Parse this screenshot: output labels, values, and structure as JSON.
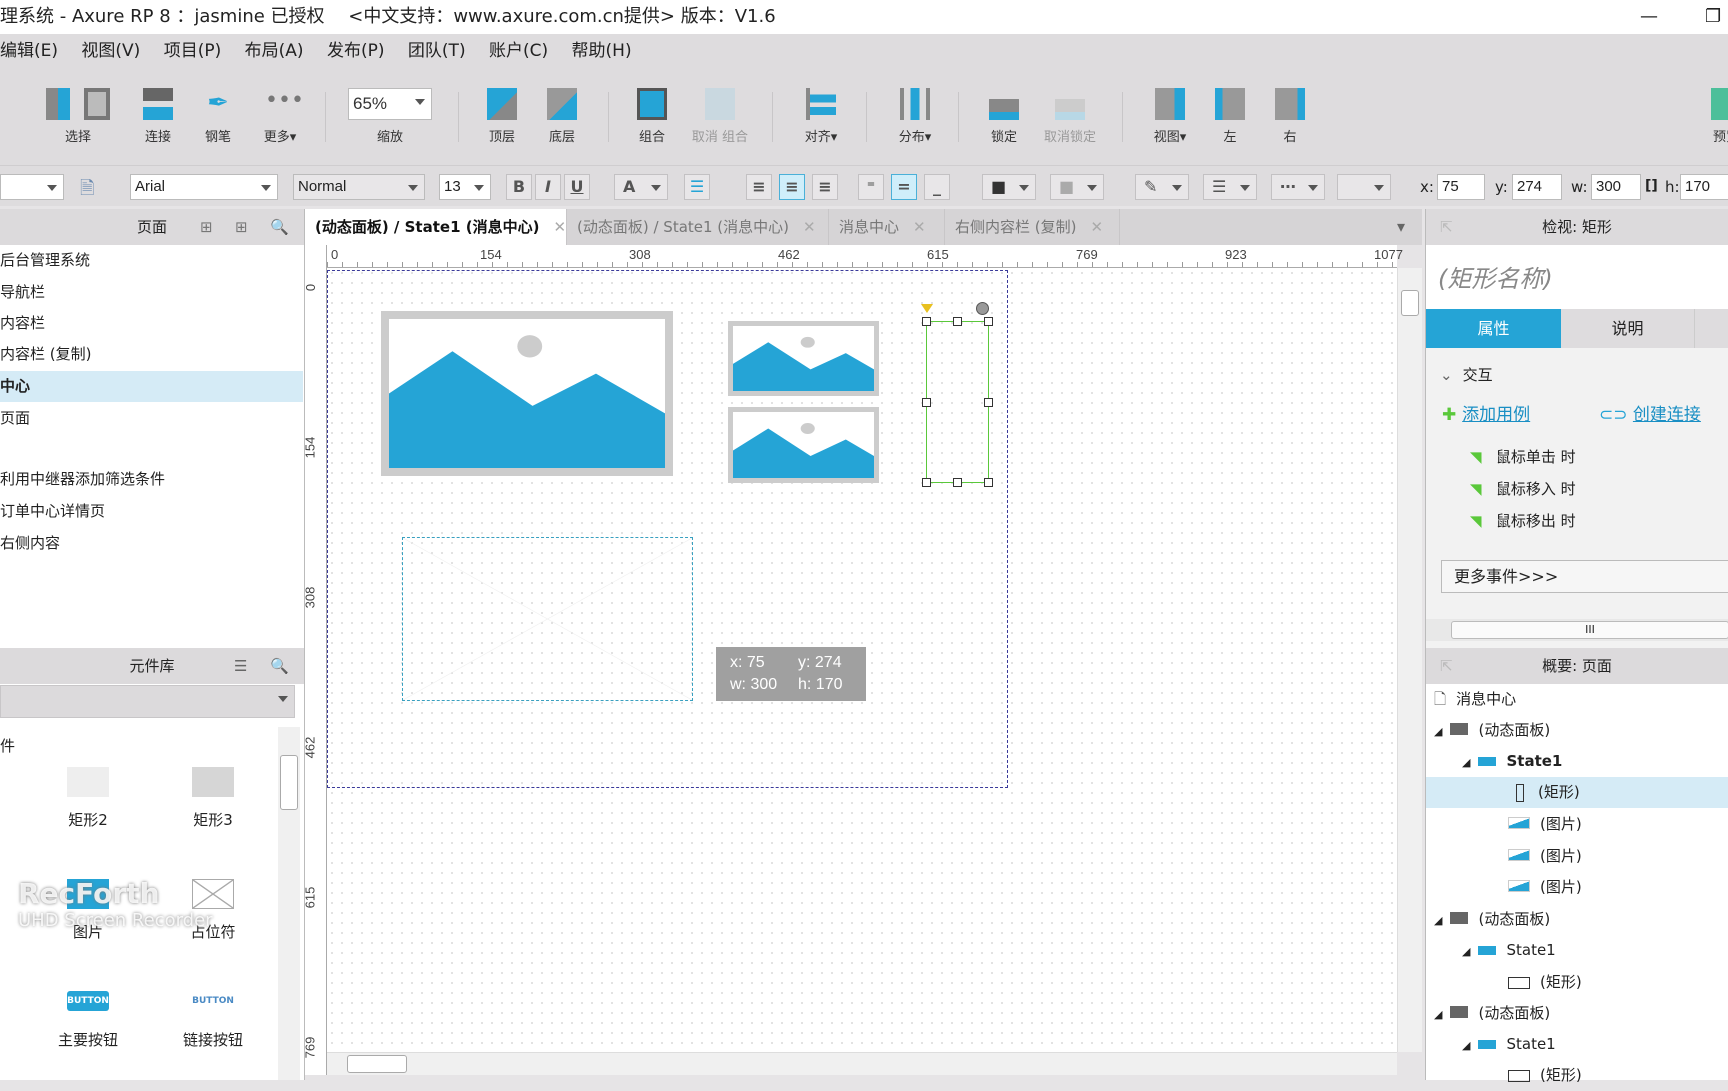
{
  "window": {
    "title": "理系统 - Axure RP 8 ：jasmine 已授权　 <中文支持：www.axure.com.cn提供> 版本：V1.6",
    "minimize": "—",
    "restore": "❐"
  },
  "menu": [
    "编辑(E)",
    "视图(V)",
    "项目(P)",
    "布局(A)",
    "发布(P)",
    "团队(T)",
    "账户(C)",
    "帮助(H)"
  ],
  "toolbar": {
    "select": "选择",
    "connect": "连接",
    "pen": "钢笔",
    "more": "更多▾",
    "zoom_value": "65%",
    "zoom_label": "缩放",
    "top": "顶层",
    "bottom": "底层",
    "group": "组合",
    "ungroup": "取消 组合",
    "align": "对齐▾",
    "distribute": "分布▾",
    "lock": "锁定",
    "unlock": "取消锁定",
    "view": "视图▾",
    "left": "左",
    "right": "右",
    "preview": "预览"
  },
  "format": {
    "font": "Arial",
    "style": "Normal",
    "size": "13",
    "bold": "B",
    "italic": "I",
    "underline": "U",
    "font_color": "A",
    "x_label": "x:",
    "x": "75",
    "y_label": "y:",
    "y": "274",
    "w_label": "w:",
    "w": "300",
    "h_label": "h:",
    "h": "170"
  },
  "pages": {
    "title": "页面",
    "items": [
      "后台管理系统",
      "导航栏",
      "内容栏",
      "内容栏 (复制)",
      "中心",
      "页面",
      "",
      "利用中继器添加筛选条件",
      "订单中心详情页",
      "右侧内容"
    ],
    "selected": 4
  },
  "library": {
    "title": "元件库",
    "section": "件",
    "widgets": [
      "矩形2",
      "矩形3",
      "图片",
      "占位符",
      "主要按钮",
      "链接按钮"
    ],
    "button_text": "BUTTON"
  },
  "tabs": [
    {
      "label": "(动态面板) / State1 (消息中心)",
      "active": true
    },
    {
      "label": "(动态面板) / State1 (消息中心)"
    },
    {
      "label": "消息中心"
    },
    {
      "label": "右侧内容栏 (复制)"
    }
  ],
  "ruler": {
    "h": [
      "0",
      "154",
      "308",
      "462",
      "615",
      "769",
      "923",
      "1077"
    ],
    "v": [
      "0",
      "154",
      "308",
      "462",
      "615",
      "769"
    ]
  },
  "canvas_tooltip": {
    "x": "x: 75",
    "y": "y: 274",
    "w": "w: 300",
    "h": "h: 170"
  },
  "inspector": {
    "title": "检视: 矩形",
    "name_placeholder": "(矩形名称)",
    "tab_props": "属性",
    "tab_notes": "说明",
    "section": "交互",
    "add_case": "添加用例",
    "create_link": "创建连接",
    "events": [
      "鼠标单击 时",
      "鼠标移入 时",
      "鼠标移出 时"
    ],
    "more_events": "更多事件>>>"
  },
  "outline": {
    "title": "概要: 页面",
    "rows": [
      {
        "label": "消息中心",
        "level": 0,
        "icon": "page"
      },
      {
        "label": "(动态面板)",
        "level": 0,
        "icon": "dynamic-panel"
      },
      {
        "label": "State1",
        "level": 1,
        "icon": "state",
        "bold": true
      },
      {
        "label": "(矩形)",
        "level": 2,
        "icon": "rect-tall",
        "selected": true
      },
      {
        "label": "(图片)",
        "level": 2,
        "icon": "image"
      },
      {
        "label": "(图片)",
        "level": 2,
        "icon": "image"
      },
      {
        "label": "(图片)",
        "level": 2,
        "icon": "image"
      },
      {
        "label": "(动态面板)",
        "level": 0,
        "icon": "dynamic-panel"
      },
      {
        "label": "State1",
        "level": 1,
        "icon": "state"
      },
      {
        "label": "(矩形)",
        "level": 2,
        "icon": "rect"
      },
      {
        "label": "(动态面板)",
        "level": 0,
        "icon": "dynamic-panel"
      },
      {
        "label": "State1",
        "level": 1,
        "icon": "state"
      },
      {
        "label": "(矩形)",
        "level": 2,
        "icon": "rect"
      }
    ]
  },
  "watermark": {
    "line1": "RecForth",
    "line2": "UHD Screen Recorder"
  },
  "colors": {
    "accent": "#25a4d6",
    "selection_green": "#5ac83a",
    "link": "#1a8fc4"
  }
}
